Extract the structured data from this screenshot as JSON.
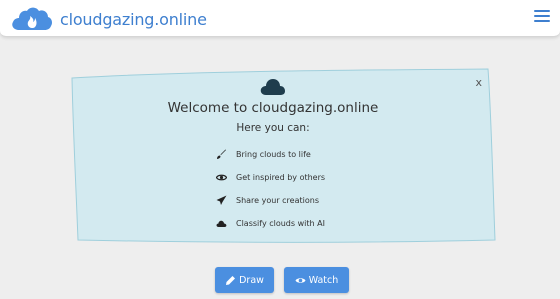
{
  "header": {
    "brand": "cloudgazing.online",
    "logo_icon": "cloud-flame-logo",
    "menu_icon": "hamburger-icon"
  },
  "welcome": {
    "close_label": "x",
    "cloud_icon": "cloud-icon",
    "title": "Welcome to cloudgazing.online",
    "subtitle": "Here you can:",
    "features": [
      {
        "icon": "brush-icon",
        "text": "Bring clouds to life"
      },
      {
        "icon": "eye-icon",
        "text": "Get inspired by others"
      },
      {
        "icon": "paper-plane-icon",
        "text": "Share your creations"
      },
      {
        "icon": "cloud-icon",
        "text": "Classify clouds with AI"
      }
    ]
  },
  "actions": {
    "draw_label": "Draw",
    "watch_label": "Watch"
  },
  "colors": {
    "accent": "#4b8fe0",
    "brand_text": "#3e7fcf",
    "card_bg": "#d3eaf0",
    "page_bg": "#eeeeee"
  }
}
